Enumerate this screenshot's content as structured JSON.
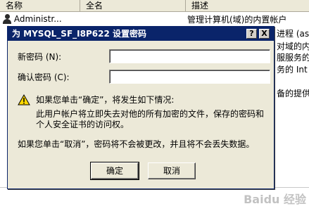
{
  "list": {
    "columns": [
      "名称",
      "全名",
      "描述"
    ],
    "row": {
      "name": "Administr...",
      "full_name": "",
      "description": "管理计算机(域)的内置帐户"
    },
    "desc_snippets": [
      "进程 (as",
      "对域的内",
      "服服务的",
      "务的 Int",
      "备的提供"
    ]
  },
  "dialog": {
    "title": "为 MYSQL_SF_I8P622 设置密码",
    "help_label": "?",
    "close_label": "X",
    "new_password_label": "新密码 (N):",
    "confirm_password_label": "确认密码 (C):",
    "new_password_value": "",
    "confirm_password_value": "",
    "warning_heading": "如果您单击“确定”，将发生如下情况:",
    "warning_line1": "此用户帐户将立即失去对他的所有加密的文件，保存的密码和",
    "warning_line2": "个人安全证书的访问权。",
    "cancel_note": "如果您单击“取消”，密码将不会被更改，并且将不会丢失数据。",
    "ok_label": "确定",
    "cancel_label": "取消"
  },
  "watermark": "Baidu 经验",
  "colors": {
    "titlebar": "#0a246a",
    "dialog_bg": "#ece9d8"
  }
}
